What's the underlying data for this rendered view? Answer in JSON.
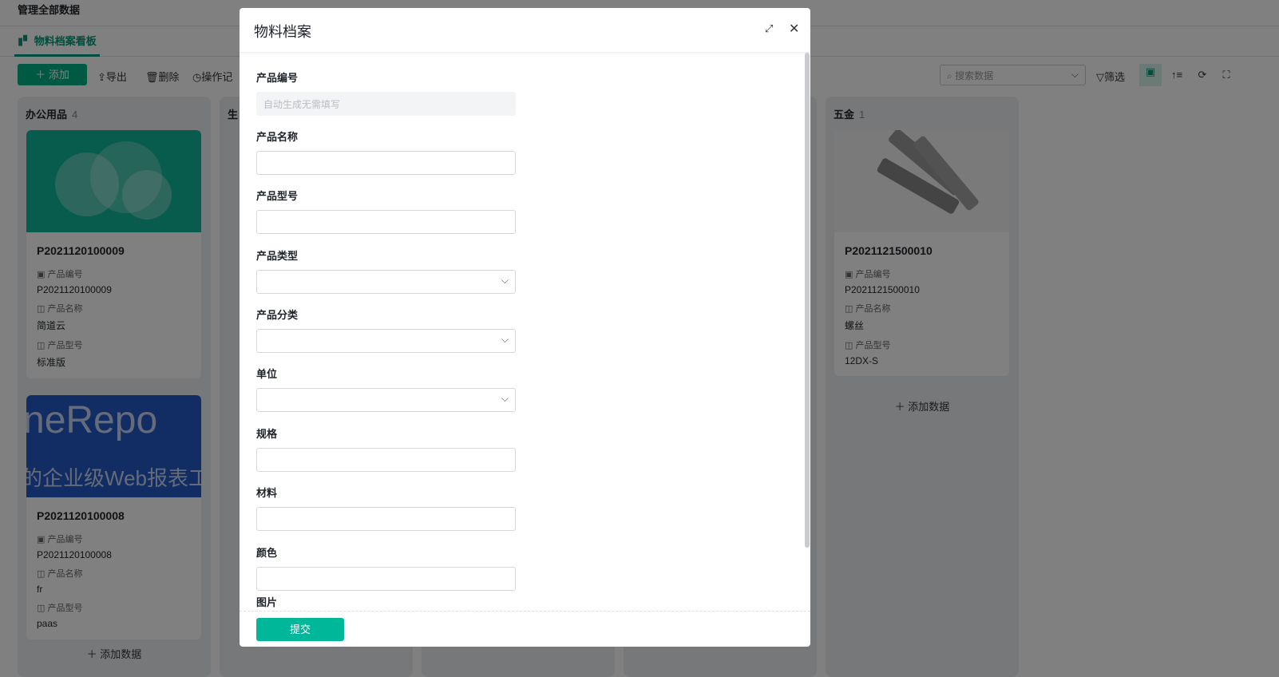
{
  "header": {
    "title": "管理全部数据"
  },
  "tab": {
    "label": "物料档案看板"
  },
  "toolbar": {
    "add": "添加",
    "export": "导出",
    "delete": "删除",
    "log": "操作记",
    "search_placeholder": "搜索数据",
    "filter": "筛选"
  },
  "columns": [
    {
      "name": "办公用品",
      "count": "4",
      "cards": [
        {
          "title": "P2021120100009",
          "f1_label": "产品编号",
          "f1": "P2021120100009",
          "f2_label": "产品名称",
          "f2": "简道云",
          "f3_label": "产品型号",
          "f3": "标准版"
        },
        {
          "title": "P2021120100008",
          "image_text1": "neRepo",
          "image_text2": "的企业级Web报表工",
          "f1_label": "产品编号",
          "f1": "P2021120100008",
          "f2_label": "产品名称",
          "f2": "fr",
          "f3_label": "产品型号",
          "f3": "paas"
        }
      ],
      "add_label": "添加数据"
    },
    {
      "name": "生"
    },
    {
      "name": "五金",
      "count": "1",
      "cards": [
        {
          "title": "P2021121500010",
          "f1_label": "产品编号",
          "f1": "P2021121500010",
          "f2_label": "产品名称",
          "f2": "螺丝",
          "f3_label": "产品型号",
          "f3": "12DX-S"
        }
      ],
      "add_label": "添加数据"
    }
  ],
  "modal": {
    "title": "物料档案",
    "fields": [
      {
        "label": "产品编号",
        "placeholder": "自动生成无需填写"
      },
      {
        "label": "产品名称"
      },
      {
        "label": "产品型号"
      },
      {
        "label": "产品类型"
      },
      {
        "label": "产品分类"
      },
      {
        "label": "单位"
      },
      {
        "label": "规格"
      },
      {
        "label": "材料"
      },
      {
        "label": "颜色"
      },
      {
        "label": "图片"
      }
    ],
    "submit": "提交"
  }
}
